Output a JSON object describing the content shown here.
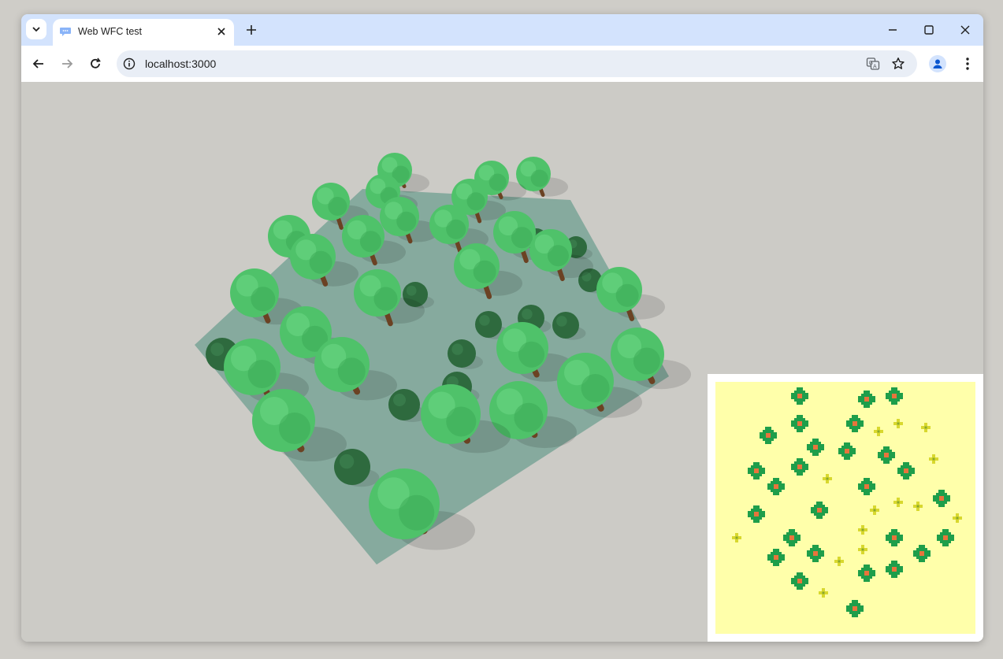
{
  "browser": {
    "tab": {
      "title": "Web WFC test"
    },
    "address_bar": {
      "url": "localhost:3000"
    },
    "icons": {
      "tab_search": "chevron-down-icon",
      "favicon": "speech-bubble-icon",
      "tab_close": "close-icon",
      "new_tab": "plus-icon",
      "minimize": "minimize-icon",
      "maximize": "maximize-icon",
      "close_window": "close-icon",
      "back": "arrow-left-icon",
      "forward": "arrow-right-icon",
      "reload": "reload-icon",
      "site_info": "info-icon",
      "translate": "translate-icon",
      "bookmark": "star-icon",
      "profile": "person-icon",
      "menu": "vertical-dots-icon"
    }
  },
  "colors": {
    "background": "#cccbc6",
    "ground": "#86aa9e",
    "tree_foliage": "#4fc26a",
    "bush": "#2e6a3e",
    "trunk": "#6b4223",
    "minimap_bg": "#ffffaa",
    "minimap_tree": "#1e9e4a",
    "minimap_tree_center": "#e8743c",
    "minimap_flower": "#d8d82e"
  }
}
